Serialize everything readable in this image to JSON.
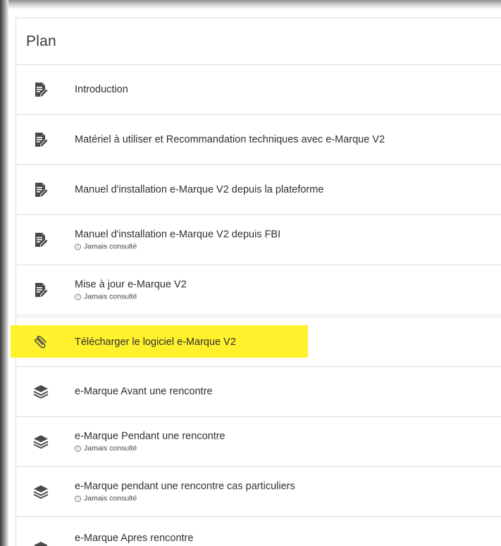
{
  "plan": {
    "title": "Plan",
    "items": [
      {
        "label": "Introduction",
        "icon": "document-edit-icon",
        "status": ""
      },
      {
        "label": "Matériel à utiliser et Recommandation techniques avec e-Marque V2",
        "icon": "document-edit-icon",
        "status": ""
      },
      {
        "label": "Manuel d'installation e-Marque V2 depuis la plateforme",
        "icon": "document-edit-icon",
        "status": ""
      },
      {
        "label": "Manuel d'installation e-Marque V2 depuis FBI",
        "icon": "document-edit-icon",
        "status": "Jamais consulté"
      },
      {
        "label": "Mise à jour e-Marque V2",
        "icon": "document-edit-icon",
        "status": "Jamais consulté"
      },
      {
        "label": "Télécharger le logiciel e-Marque V2",
        "icon": "paperclip-icon",
        "status": ""
      },
      {
        "label": "e-Marque Avant une rencontre",
        "icon": "layers-icon",
        "status": ""
      },
      {
        "label": "e-Marque Pendant une rencontre",
        "icon": "layers-icon",
        "status": "Jamais consulté"
      },
      {
        "label": "e-Marque pendant une rencontre cas particuliers",
        "icon": "layers-icon",
        "status": "Jamais consulté"
      },
      {
        "label": "e-Marque Apres rencontre",
        "icon": "layers-icon",
        "status": ""
      }
    ],
    "info_glyph": "i"
  },
  "colors": {
    "highlight": "#fff12b",
    "icon": "#4a4a4a",
    "text": "#2f2f2f"
  }
}
